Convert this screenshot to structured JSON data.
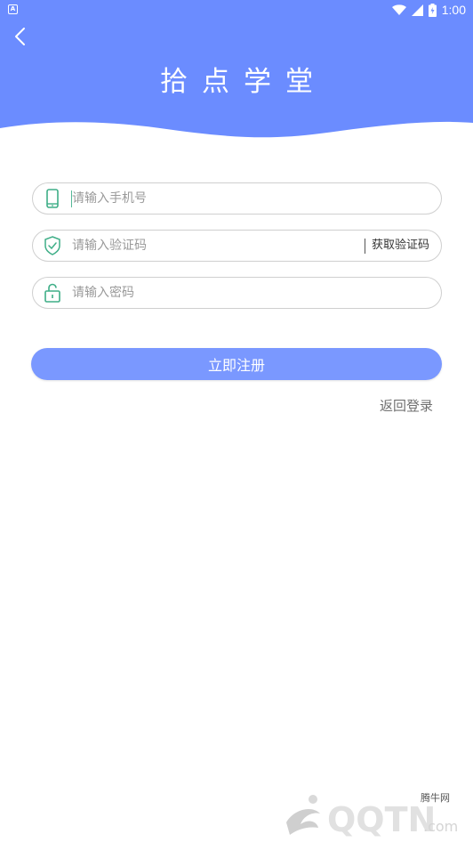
{
  "status_bar": {
    "left_badge": "A",
    "time": "1:00",
    "icons": [
      "wifi-icon",
      "signal-icon",
      "battery-icon"
    ]
  },
  "header": {
    "title": "拾点学堂",
    "back_icon": "chevron-left-icon"
  },
  "form": {
    "phone": {
      "placeholder": "请输入手机号",
      "icon": "phone-icon"
    },
    "code": {
      "placeholder": "请输入验证码",
      "icon": "shield-check-icon",
      "get_code_label": "获取验证码"
    },
    "password": {
      "placeholder": "请输入密码",
      "icon": "lock-icon"
    }
  },
  "actions": {
    "register_label": "立即注册",
    "back_login_label": "返回登录"
  },
  "watermark": {
    "small_text": "腾牛网",
    "logo_text": "QQTN.com"
  },
  "colors": {
    "primary": "#6b8cff",
    "button": "#7a98ff",
    "icon_accent": "#3eae87"
  }
}
